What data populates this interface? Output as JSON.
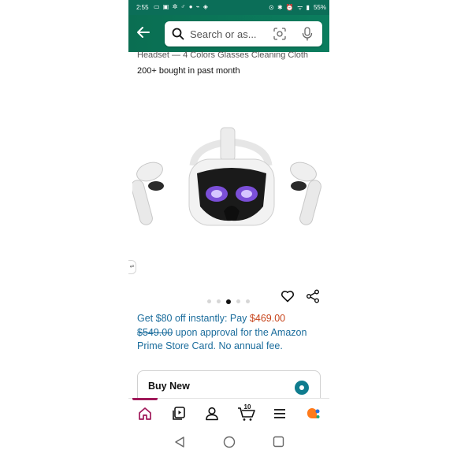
{
  "status_bar": {
    "time": "2:55",
    "left_icons": "▭ ▣ ✲ ♂ ● ⌁ ◈",
    "right_icons": "⊙ ✱ ⏰ ᯤ ▮",
    "battery": "55%"
  },
  "header": {
    "search_placeholder": "Search or as..."
  },
  "product": {
    "title_fragment": "Headset — 4 Colors Glasses Cleaning Cloth",
    "bought_text": "200+ bought in past month"
  },
  "gallery": {
    "side_handle_glyph": "⇌",
    "dot_count": 5,
    "active_dot": 2
  },
  "promo": {
    "line1_prefix": "Get $80 off instantly: Pay ",
    "new_price": "$469.00",
    "old_price": "$549.00",
    "line_rest": " upon approval for the Amazon Prime Store Card. No annual fee."
  },
  "buybox": {
    "label": "Buy New"
  },
  "bottom_nav": {
    "cart_count": "10",
    "colors": {
      "active": "#a0195a",
      "ai": "#ff7a1a"
    }
  },
  "icons": {
    "back": "back-arrow-icon",
    "search": "search-icon",
    "camera": "camera-scan-icon",
    "mic": "microphone-icon",
    "heart": "heart-icon",
    "share": "share-icon"
  }
}
